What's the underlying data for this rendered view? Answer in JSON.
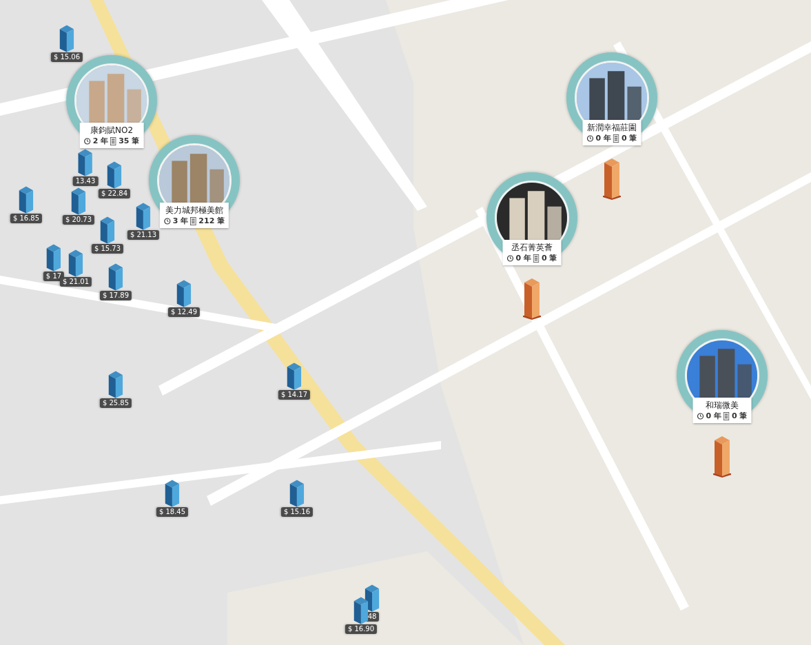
{
  "price_markers": [
    {
      "price": "$ 15.06"
    },
    {
      "price": "13.43"
    },
    {
      "price": "$ 22.84"
    },
    {
      "price": "$ 16.85"
    },
    {
      "price": "$ 20.73"
    },
    {
      "price": "$ 21.13"
    },
    {
      "price": "$ 15.73"
    },
    {
      "price": "$ 17"
    },
    {
      "price": "$ 21.01"
    },
    {
      "price": "$ 17.89"
    },
    {
      "price": "$ 12.49"
    },
    {
      "price": "$ 25.85"
    },
    {
      "price": "$ 14.17"
    },
    {
      "price": "$ 18.45"
    },
    {
      "price": "$ 15.16"
    },
    {
      "price": "48"
    },
    {
      "price": "$ 16.90"
    }
  ],
  "projects": [
    {
      "name": "康鈞賦NO2",
      "age": "2 年",
      "count": "35 筆",
      "pillar": false
    },
    {
      "name": "美力城邦極美館",
      "age": "3 年",
      "count": "212 筆",
      "pillar": false
    },
    {
      "name": "新潤幸福莊園",
      "age": "0 年",
      "count": "0 筆",
      "pillar": true
    },
    {
      "name": "丞石菁英薈",
      "age": "0 年",
      "count": "0 筆",
      "pillar": true
    },
    {
      "name": "和瑞微美",
      "age": "0 年",
      "count": "0 筆",
      "pillar": true
    }
  ]
}
